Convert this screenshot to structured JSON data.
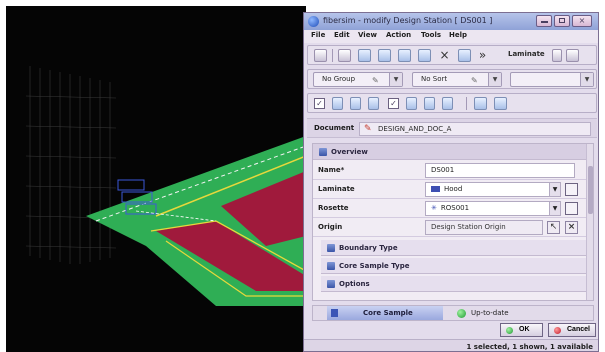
{
  "window": {
    "title": "fibersim - modify Design Station [ DS001 ]",
    "close_glyph": "×"
  },
  "menu": [
    "File",
    "Edit",
    "View",
    "Action",
    "Tools",
    "Help"
  ],
  "toolbar1": {
    "laminate_label": "Laminate"
  },
  "toolbar2": {
    "group_combo": "No Group",
    "sort_combo": "No Sort",
    "blank_combo": ""
  },
  "document": {
    "label": "Document",
    "value": "DESIGN_AND_DOC_A"
  },
  "sections": {
    "overview": "Overview",
    "boundary_type": "Boundary Type",
    "core_sample_type": "Core Sample Type",
    "options": "Options"
  },
  "fields": {
    "name_label": "Name*",
    "name_value": "DS001",
    "laminate_label": "Laminate",
    "laminate_value": "Hood",
    "rosette_label": "Rosette",
    "rosette_value": "ROS001",
    "origin_label": "Origin",
    "origin_value": "Design Station Origin"
  },
  "status": {
    "object": "Core Sample",
    "state": "Up-to-date"
  },
  "buttons": {
    "ok": "OK",
    "cancel": "Cancel"
  },
  "footer": "1 selected, 1 shown, 1 available",
  "colors": {
    "viewport_bg": "#050505",
    "ply_green": "#2fae55",
    "ply_red": "#a01a3c",
    "ply_yellow": "#e6d83c",
    "titlebar": "#9fb0df",
    "dialog_bg": "#e3dcec"
  },
  "icons": {
    "app": "fibersim-logo-icon",
    "document": "document-pencil-icon",
    "section": "section-collapse-icon",
    "ok": "green-dot-icon",
    "cancel": "red-dot-icon"
  }
}
